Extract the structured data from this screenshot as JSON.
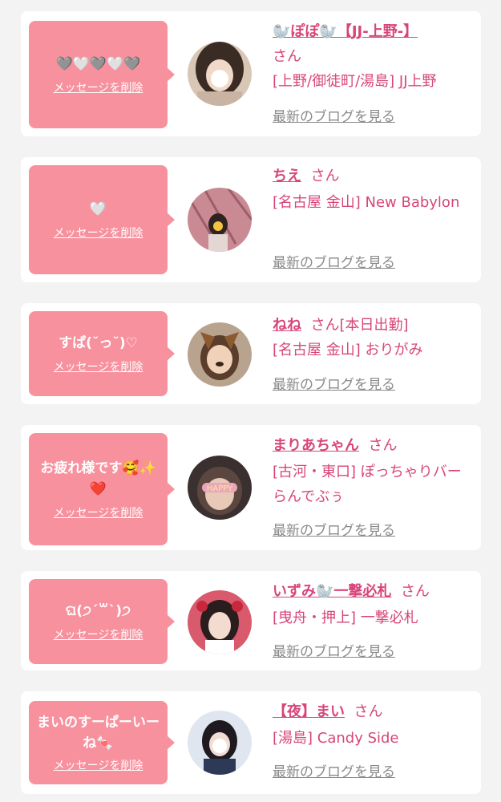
{
  "colors": {
    "page_bg": "#f3f3f3",
    "card_bg": "#ffffff",
    "bubble_bg": "#f7919e",
    "name_color": "#d7467a",
    "blog_link_color": "#8a8a8a"
  },
  "cards": [
    {
      "message": "🩶🤍🩶🤍🩶",
      "delete_label": "メッセージを削除",
      "name": "🦭ぽぽ🦭【JJ-上野-】",
      "san": "さん",
      "shop": "[上野/御徒町/湯島] JJ上野",
      "blog_label": "最新のブログを見る",
      "avatar_icon": "girl-photo-avatar"
    },
    {
      "message": "🤍",
      "delete_label": "メッセージを削除",
      "name": "ちえ",
      "san": "さん",
      "shop": "[名古屋 金山] New Babylon",
      "blog_label": "最新のブログを見る",
      "avatar_icon": "girl-photo-avatar"
    },
    {
      "message": "すぱ(˘っ˘)♡",
      "delete_label": "メッセージを削除",
      "name": "ねね",
      "san": "さん[本日出勤]",
      "shop": "[名古屋 金山] おりがみ",
      "blog_label": "最新のブログを見る",
      "avatar_icon": "girl-photo-avatar"
    },
    {
      "message": "お疲れ様です🥰✨❤️",
      "delete_label": "メッセージを削除",
      "name": "まりあちゃん",
      "san": "さん",
      "shop": "[古河・東口] ぽっちゃりバー らんでぶぅ",
      "blog_label": "最新のブログを見る",
      "avatar_icon": "girl-photo-avatar"
    },
    {
      "message": "ଘ(੭ˊ꒳ˋ)੭",
      "delete_label": "メッセージを削除",
      "name": "いずみ🦭一撃必札",
      "san": "さん",
      "shop": "[曳舟・押上] 一撃必札",
      "blog_label": "最新のブログを見る",
      "avatar_icon": "girl-photo-avatar"
    },
    {
      "message": "まいのすーぱーいーね🍬",
      "delete_label": "メッセージを削除",
      "name": "【夜】まい",
      "san": "さん",
      "shop": "[湯島] Candy Side",
      "blog_label": "最新のブログを見る",
      "avatar_icon": "girl-photo-avatar"
    }
  ]
}
